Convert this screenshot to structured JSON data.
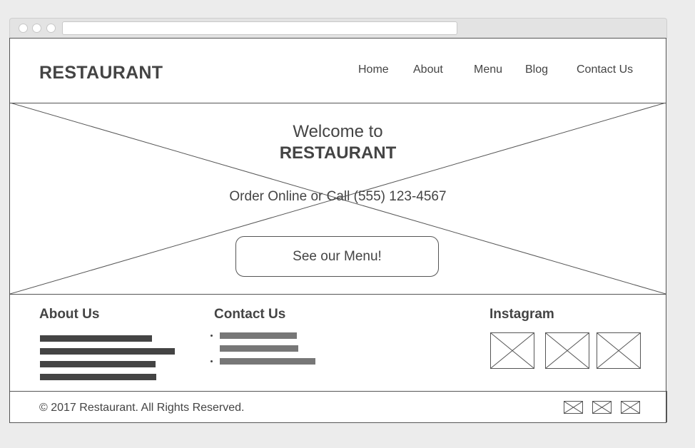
{
  "header": {
    "logo": "RESTAURANT",
    "nav": [
      "Home",
      "About",
      "Menu",
      "Blog",
      "Contact Us"
    ]
  },
  "hero": {
    "welcome": "Welcome to",
    "brand": "RESTAURANT",
    "order_text": "Order Online or Call (555) 123-4567",
    "cta_label": "See our Menu!"
  },
  "sections": {
    "about_title": "About Us",
    "contact_title": "Contact Us",
    "instagram_title": "Instagram"
  },
  "footer": {
    "copyright": "© 2017 Restaurant. All Rights Reserved."
  }
}
